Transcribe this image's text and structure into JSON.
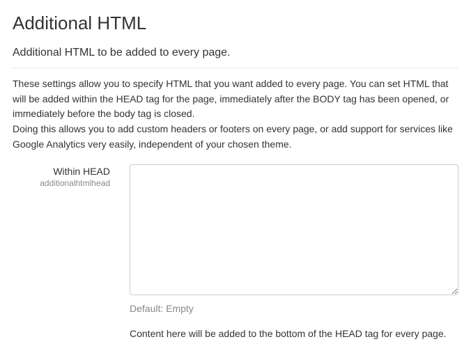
{
  "page": {
    "title": "Additional HTML",
    "subtitle": "Additional HTML to be added to every page.",
    "description_p1": "These settings allow you to specify HTML that you want added to every page. You can set HTML that will be added within the HEAD tag for the page, immediately after the BODY tag has been opened, or immediately before the body tag is closed.",
    "description_p2": "Doing this allows you to add custom headers or footers on every page, or add support for services like Google Analytics very easily, independent of your chosen theme."
  },
  "fields": {
    "withinHead": {
      "label": "Within HEAD",
      "name": "additionalhtmlhead",
      "value": "",
      "default_hint": "Default: Empty",
      "help": "Content here will be added to the bottom of the HEAD tag for every page."
    }
  }
}
